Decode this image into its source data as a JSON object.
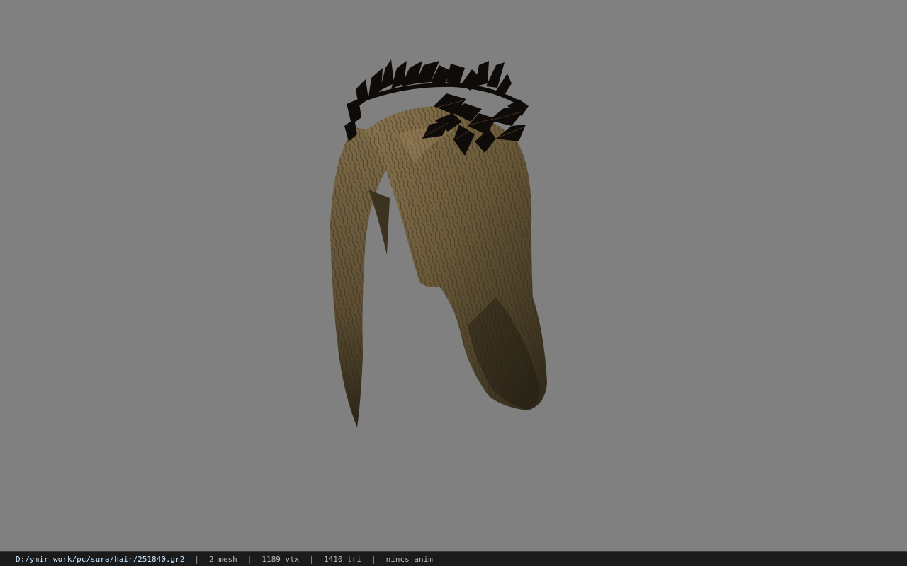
{
  "viewport": {
    "background_color": "#808080",
    "model": {
      "subject": "hair-mesh-with-leaf-crown",
      "hair_color": "#6b5a3a",
      "crown_color": "#0e0b08"
    }
  },
  "status_bar": {
    "file_path": "D:/ymir work/pc/sura/hair/251840.gr2",
    "mesh_count": "2 mesh",
    "vertex_count": "1189 vtx",
    "triangle_count": "1410 tri",
    "anim_status": "nincs anim",
    "separator": "|"
  }
}
